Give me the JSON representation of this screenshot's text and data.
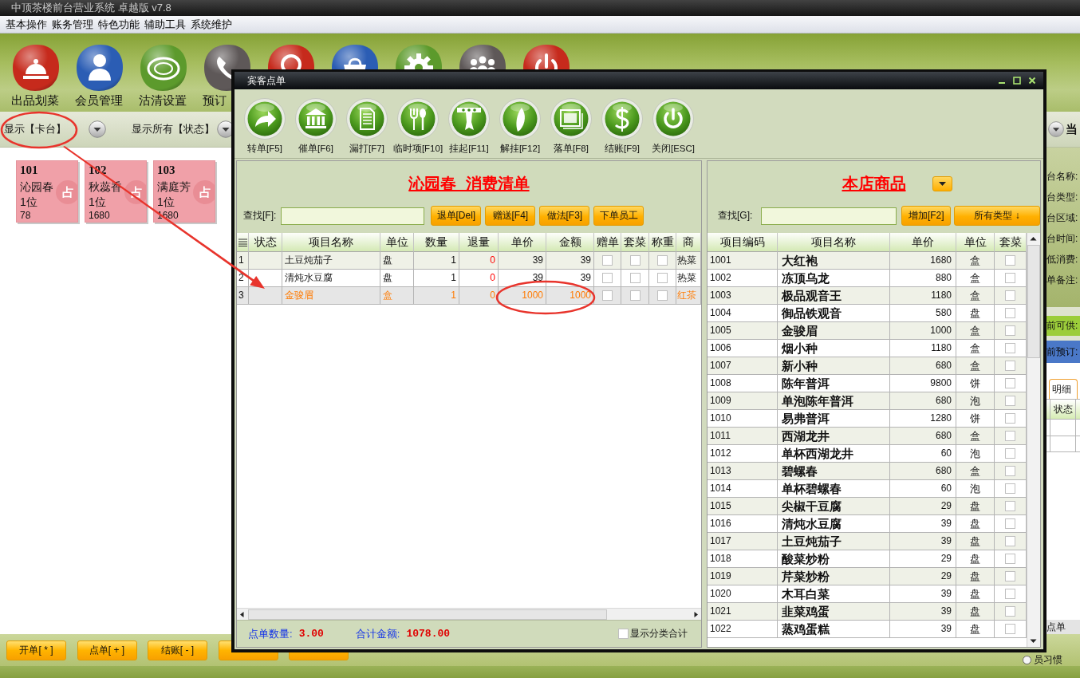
{
  "window": {
    "title": "中顶茶楼前台营业系统 卓越版 v7.8"
  },
  "menu": [
    "基本操作",
    "账务管理",
    "特色功能",
    "辅助工具",
    "系统维护"
  ],
  "toolbar": [
    {
      "label": "出品划菜",
      "color": "#c62a1c"
    },
    {
      "label": "会员管理",
      "color": "#2b5db4"
    },
    {
      "label": "沽清设置",
      "color": "#5c9a2c"
    },
    {
      "label": "预订",
      "color": "#5e5858"
    },
    {
      "color": "#c62a1c"
    },
    {
      "color": "#2b5db4"
    },
    {
      "color": "#5c9a2c"
    },
    {
      "color": "#5e5858"
    },
    {
      "color": "#c62a1c"
    }
  ],
  "filters": [
    "显示【卡台】",
    "显示所有【状态】"
  ],
  "tables": [
    {
      "number": "101",
      "name": "沁园春",
      "guests": "1位",
      "amount": "78",
      "badge": "占"
    },
    {
      "number": "102",
      "name": "秋蕊香",
      "guests": "1位",
      "amount": "1680",
      "badge": "占"
    },
    {
      "number": "103",
      "name": "满庭芳",
      "guests": "1位",
      "amount": "1680",
      "badge": "占"
    }
  ],
  "side_panel": {
    "heading": "当",
    "fields": [
      "台名称:",
      "台类型:",
      "台区域:",
      "台时间:",
      "低消费:",
      "单备注:"
    ],
    "available": "前可供:",
    "reserved": "前预订:",
    "tab": {
      "label": "明细",
      "selected": true
    },
    "columns": [
      "状态"
    ],
    "footer": "点单"
  },
  "bottom_buttons": [
    {
      "kind": "labeled",
      "label": "开单[ * ]"
    },
    {
      "kind": "labeled",
      "label": "点单[ + ]"
    },
    {
      "kind": "labeled",
      "label": "结账[ - ]"
    },
    {
      "kind": "covered"
    },
    {
      "kind": "covered"
    }
  ],
  "habit": {
    "label": "员习惯",
    "selected": false
  },
  "dialog": {
    "title": "宾客点单",
    "tools": [
      "转单[F5]",
      "催单[F6]",
      "漏打[F7]",
      "临时项[F10]",
      "挂起[F11]",
      "解挂[F12]",
      "落单[F8]",
      "结账[F9]",
      "关闭[ESC]"
    ],
    "bill": {
      "title": "沁园春  消费清单",
      "search_label": "查找[F]:",
      "buttons": [
        "退单[Del]",
        "赠送[F4]",
        "做法[F3]",
        "下单员工"
      ],
      "columns": [
        "状态",
        "项目名称",
        "单位",
        "数量",
        "退量",
        "单价",
        "金额",
        "赠单",
        "套菜",
        "称重",
        "商"
      ],
      "rows": [
        {
          "no": "1",
          "name": "土豆炖茄子",
          "unit": "盘",
          "qty": "1",
          "returned": "0",
          "price": "39",
          "amount": "39",
          "gift": false,
          "set": false,
          "weighed": false,
          "category": "热菜",
          "selected": false
        },
        {
          "no": "2",
          "name": "清炖水豆腐",
          "unit": "盘",
          "qty": "1",
          "returned": "0",
          "price": "39",
          "amount": "39",
          "gift": false,
          "set": false,
          "weighed": false,
          "category": "热菜",
          "selected": false
        },
        {
          "no": "3",
          "name": "金骏眉",
          "unit": "盒",
          "qty": "1",
          "returned": "0",
          "price": "1000",
          "amount": "1000",
          "gift": false,
          "set": false,
          "weighed": false,
          "category": "红茶",
          "selected": true
        }
      ],
      "summary": {
        "count_label": "点单数量:",
        "count": "3.00",
        "total_label": "合计金额:",
        "total": "1078.00",
        "option": {
          "label": "显示分类合计",
          "checked": false
        }
      }
    },
    "goods": {
      "title": "本店商品",
      "search_label": "查找[G]:",
      "add_button": "增加[F2]",
      "type_button": "所有类型 ↓",
      "columns": [
        "项目编码",
        "项目名称",
        "单价",
        "单位",
        "套菜"
      ],
      "rows": [
        {
          "code": "1001",
          "name": "大红袍",
          "price": "1680",
          "unit": "盒",
          "set": false
        },
        {
          "code": "1002",
          "name": "冻顶乌龙",
          "price": "880",
          "unit": "盒",
          "set": false
        },
        {
          "code": "1003",
          "name": "极品观音王",
          "price": "1180",
          "unit": "盒",
          "set": false
        },
        {
          "code": "1004",
          "name": "御品铁观音",
          "price": "580",
          "unit": "盘",
          "set": false
        },
        {
          "code": "1005",
          "name": "金骏眉",
          "price": "1000",
          "unit": "盒",
          "set": false
        },
        {
          "code": "1006",
          "name": "烟小种",
          "price": "1180",
          "unit": "盒",
          "set": false
        },
        {
          "code": "1007",
          "name": "新小种",
          "price": "680",
          "unit": "盒",
          "set": false
        },
        {
          "code": "1008",
          "name": "陈年普洱",
          "price": "9800",
          "unit": "饼",
          "set": false
        },
        {
          "code": "1009",
          "name": "单泡陈年普洱",
          "price": "680",
          "unit": "泡",
          "set": false
        },
        {
          "code": "1010",
          "name": "易弗普洱",
          "price": "1280",
          "unit": "饼",
          "set": false
        },
        {
          "code": "1011",
          "name": "西湖龙井",
          "price": "680",
          "unit": "盒",
          "set": false
        },
        {
          "code": "1012",
          "name": "单杯西湖龙井",
          "price": "60",
          "unit": "泡",
          "set": false
        },
        {
          "code": "1013",
          "name": "碧螺春",
          "price": "680",
          "unit": "盒",
          "set": false
        },
        {
          "code": "1014",
          "name": "单杯碧螺春",
          "price": "60",
          "unit": "泡",
          "set": false
        },
        {
          "code": "1015",
          "name": "尖椒干豆腐",
          "price": "29",
          "unit": "盘",
          "set": false
        },
        {
          "code": "1016",
          "name": "清炖水豆腐",
          "price": "39",
          "unit": "盘",
          "set": false
        },
        {
          "code": "1017",
          "name": "土豆炖茄子",
          "price": "39",
          "unit": "盘",
          "set": false
        },
        {
          "code": "1018",
          "name": "酸菜炒粉",
          "price": "29",
          "unit": "盘",
          "set": false
        },
        {
          "code": "1019",
          "name": "芹菜炒粉",
          "price": "29",
          "unit": "盘",
          "set": false
        },
        {
          "code": "1020",
          "name": "木耳白菜",
          "price": "39",
          "unit": "盘",
          "set": false
        },
        {
          "code": "1021",
          "name": "韭菜鸡蛋",
          "price": "39",
          "unit": "盘",
          "set": false
        },
        {
          "code": "1022",
          "name": "蒸鸡蛋糕",
          "price": "39",
          "unit": "盘",
          "set": false
        }
      ]
    }
  }
}
